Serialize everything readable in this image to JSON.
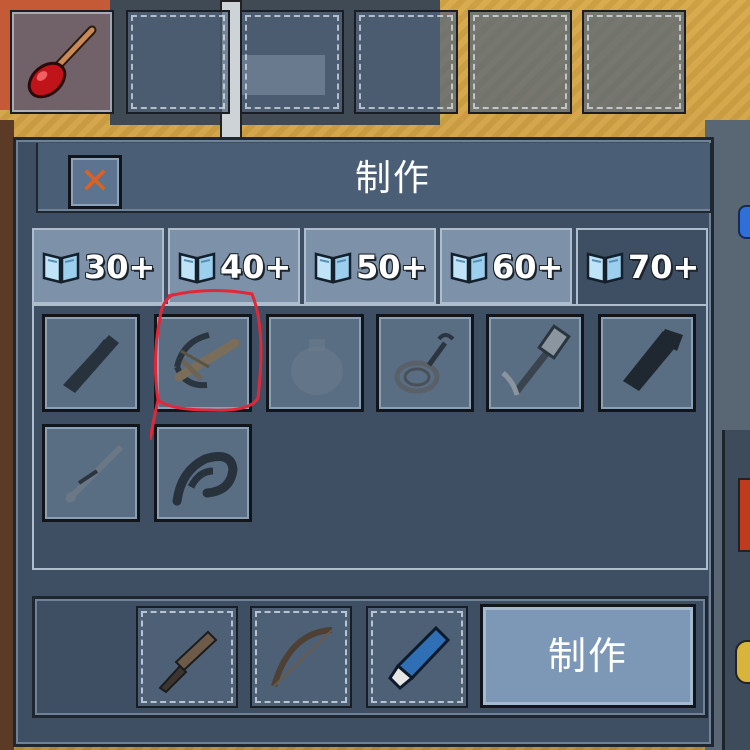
{
  "hotbar": {
    "slots": [
      {
        "item": "plunger-icon",
        "filled": true
      },
      {
        "item": null,
        "filled": false
      },
      {
        "item": null,
        "filled": false
      },
      {
        "item": null,
        "filled": false
      },
      {
        "item": null,
        "filled": false
      },
      {
        "item": null,
        "filled": false
      }
    ]
  },
  "window": {
    "title": "制作",
    "close_icon": "close-x-icon",
    "close_symbol": "✕"
  },
  "tabs": [
    {
      "label": "30+",
      "icon": "book-icon",
      "active": false
    },
    {
      "label": "40+",
      "icon": "book-icon",
      "active": false
    },
    {
      "label": "50+",
      "icon": "book-icon",
      "active": false
    },
    {
      "label": "60+",
      "icon": "book-icon",
      "active": false
    },
    {
      "label": "70+",
      "icon": "book-icon",
      "active": true
    }
  ],
  "recipes": [
    {
      "icon": "baton-icon",
      "locked": true
    },
    {
      "icon": "crossbow-icon",
      "locked": false,
      "highlighted": true
    },
    {
      "icon": "pot-icon",
      "locked": true
    },
    {
      "icon": "grappling-hook-icon",
      "locked": true
    },
    {
      "icon": "pickaxe-icon",
      "locked": true
    },
    {
      "icon": "spiked-club-icon",
      "locked": true
    },
    {
      "icon": "dart-gun-icon",
      "locked": true
    },
    {
      "icon": "whip-icon",
      "locked": true
    }
  ],
  "ingredients": [
    {
      "icon": "knife-icon"
    },
    {
      "icon": "bow-icon"
    },
    {
      "icon": "glue-tube-icon"
    }
  ],
  "craft_button": {
    "label": "制作"
  },
  "colors": {
    "window_bg": "#3e4f63",
    "tab_inactive": "#7d91a8",
    "craft_button": "#7d97b6",
    "annotation_red": "#e0283a"
  }
}
